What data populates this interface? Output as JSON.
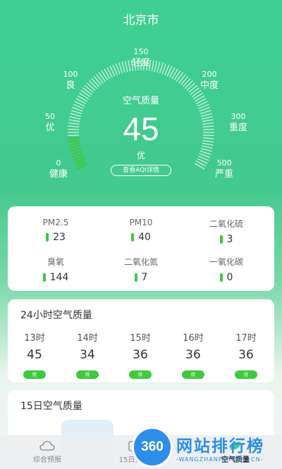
{
  "header": {
    "city": "北京市"
  },
  "gauge": {
    "title": "空气质量",
    "value": "45",
    "value_num": 45,
    "max": 500,
    "level": "优",
    "detail_link": "查看AQI详情",
    "ticks": [
      {
        "num": "0",
        "level": "健康"
      },
      {
        "num": "50",
        "level": "优"
      },
      {
        "num": "100",
        "level": "良"
      },
      {
        "num": "150",
        "level": "轻度"
      },
      {
        "num": "200",
        "level": "中度"
      },
      {
        "num": "300",
        "level": "重度"
      },
      {
        "num": "500",
        "level": "严重"
      }
    ],
    "accent_color": "#3fc93f"
  },
  "pollutants": [
    {
      "name": "PM2.5",
      "value": "23"
    },
    {
      "name": "PM10",
      "value": "40"
    },
    {
      "name": "二氧化硫",
      "value": "3"
    },
    {
      "name": "臭氧",
      "value": "144"
    },
    {
      "name": "二氧化氮",
      "value": "7"
    },
    {
      "name": "一氧化碳",
      "value": "0"
    }
  ],
  "hourly": {
    "title": "24小时空气质量",
    "hours": [
      {
        "time": "13时",
        "value": "45",
        "badge": "优"
      },
      {
        "time": "14时",
        "value": "34",
        "badge": "优"
      },
      {
        "time": "15时",
        "value": "36",
        "badge": "优"
      },
      {
        "time": "16时",
        "value": "36",
        "badge": "优"
      },
      {
        "time": "17时",
        "value": "36",
        "badge": "优"
      }
    ]
  },
  "days": {
    "title": "15日空气质量"
  },
  "nav": {
    "items": [
      {
        "label": "综合预报",
        "icon": "cloud-icon"
      },
      {
        "label": "15日天气",
        "icon": "calendar-icon"
      },
      {
        "label": "空气质量",
        "icon": "leaf-icon"
      }
    ]
  },
  "watermark": {
    "logo": "360",
    "text": "网站排行榜",
    "sub": "-WANGZHANPAIHANG.CN-"
  }
}
